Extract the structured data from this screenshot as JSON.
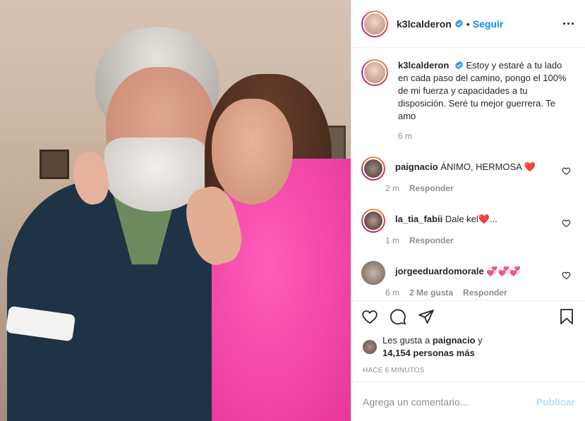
{
  "post": {
    "username": "k3lcalderon",
    "follow_label": "Seguir",
    "caption_text": "Estoy y estaré a tu lado en cada paso del camino, pongo el 100% de mi fuerza y capacidades a tu disposición. Seré tu mejor guerrera. Te amo",
    "caption_time": "6 m"
  },
  "comments": [
    {
      "username": "paignacio",
      "text": "ÁNIMO, HERMOSA ❤️",
      "time": "2 m",
      "reply": "Responder",
      "likes": ""
    },
    {
      "username": "la_tia_fabii",
      "text": "Dale kel❤️...",
      "time": "1 m",
      "reply": "Responder",
      "likes": ""
    },
    {
      "username": "jorgeeduardomorale",
      "text": "💞💞💞",
      "time": "6 m",
      "reply": "Responder",
      "likes": "2 Me gusta"
    }
  ],
  "likes": {
    "prefix": "Les gusta a",
    "user": "paignacio",
    "conj": "y",
    "count": "14,154 personas más"
  },
  "posted_ago": "HACE 6 MINUTOS",
  "add_comment": {
    "placeholder": "Agrega un comentario...",
    "post_label": "Publicar"
  },
  "colors": {
    "accent": "#0095f6",
    "verified": "#3897f0",
    "muted": "#8e8e8e",
    "heart": "#ed4956"
  },
  "icons": [
    "verified-icon",
    "more-options-icon",
    "like-icon",
    "comment-icon",
    "share-icon",
    "save-icon",
    "comment-like-icon"
  ]
}
